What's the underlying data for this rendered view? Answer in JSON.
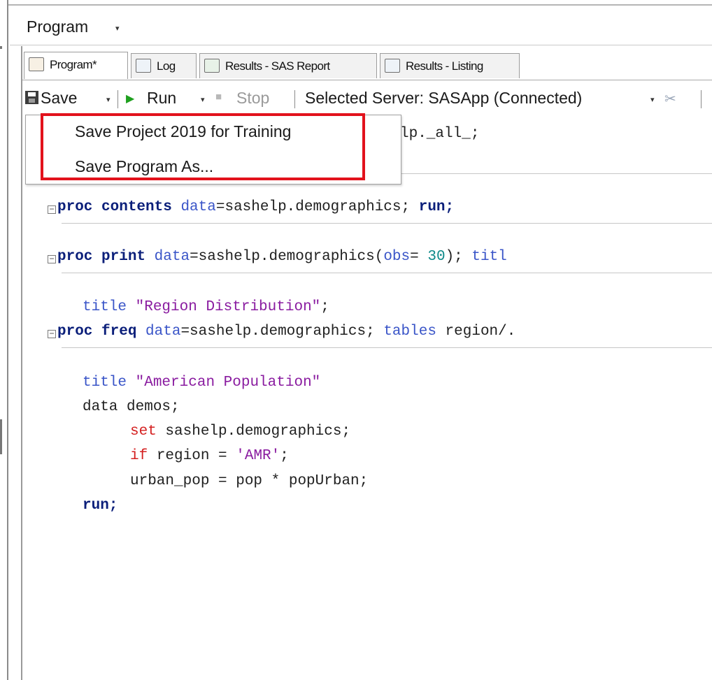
{
  "window": {
    "title": "Program",
    "title_arrow": "▾"
  },
  "tabs": [
    {
      "label": "Program*",
      "icon": "program-icon",
      "active": true
    },
    {
      "label": "Log",
      "icon": "log-icon",
      "active": false
    },
    {
      "label": "Results - SAS Report",
      "icon": "sas-report-icon",
      "active": false
    },
    {
      "label": "Results - Listing",
      "icon": "listing-icon",
      "active": false
    }
  ],
  "toolbar": {
    "save_label": "Save",
    "run_label": "Run",
    "stop_label": "Stop",
    "server_label": "Selected Server: SASApp (Connected)",
    "dropdown_arrow": "▾",
    "run_icon": "▶",
    "stop_icon": "■",
    "disconnect_icon": "✂"
  },
  "save_menu": {
    "items": [
      "Save Project 2019 for Training",
      "Save Program As..."
    ],
    "highlight_color": "#e2121c"
  },
  "code": {
    "line0_tail": "lp._all_;",
    "line1": {
      "kw": "proc contents",
      "attr": "data",
      "rest": "=sashelp.demographics; ",
      "run": "run;"
    },
    "line2": {
      "kw": "proc print",
      "attr": "data",
      "mid": "=sashelp.demographics(",
      "attr2": "obs",
      "eq": "= ",
      "num": "30",
      "close": "); ",
      "title_kw": "titl"
    },
    "line3": {
      "kw": "title",
      "str": "\"Region Distribution\"",
      "semi": ";"
    },
    "line4": {
      "kw": "proc freq",
      "attr": "data",
      "rest": "=sashelp.demographics; ",
      "attr2": "tables",
      "tail": " region/."
    },
    "line5": {
      "kw": "title",
      "str": "\"American Population\""
    },
    "line6": "data demos;",
    "line7": {
      "kw": "set",
      "rest": " sashelp.demographics;"
    },
    "line8": {
      "kw": "if",
      "rest": " region = ",
      "str": "'AMR'",
      "semi": ";"
    },
    "line9": "urban_pop = pop * popUrban;",
    "line10": "run;"
  },
  "colors": {
    "keyword": "#0b1f7a",
    "attribute": "#3a55c8",
    "string": "#8a1ca0",
    "number": "#0f8a8a",
    "statement_red": "#d42020",
    "run_green": "#1fa01f"
  }
}
